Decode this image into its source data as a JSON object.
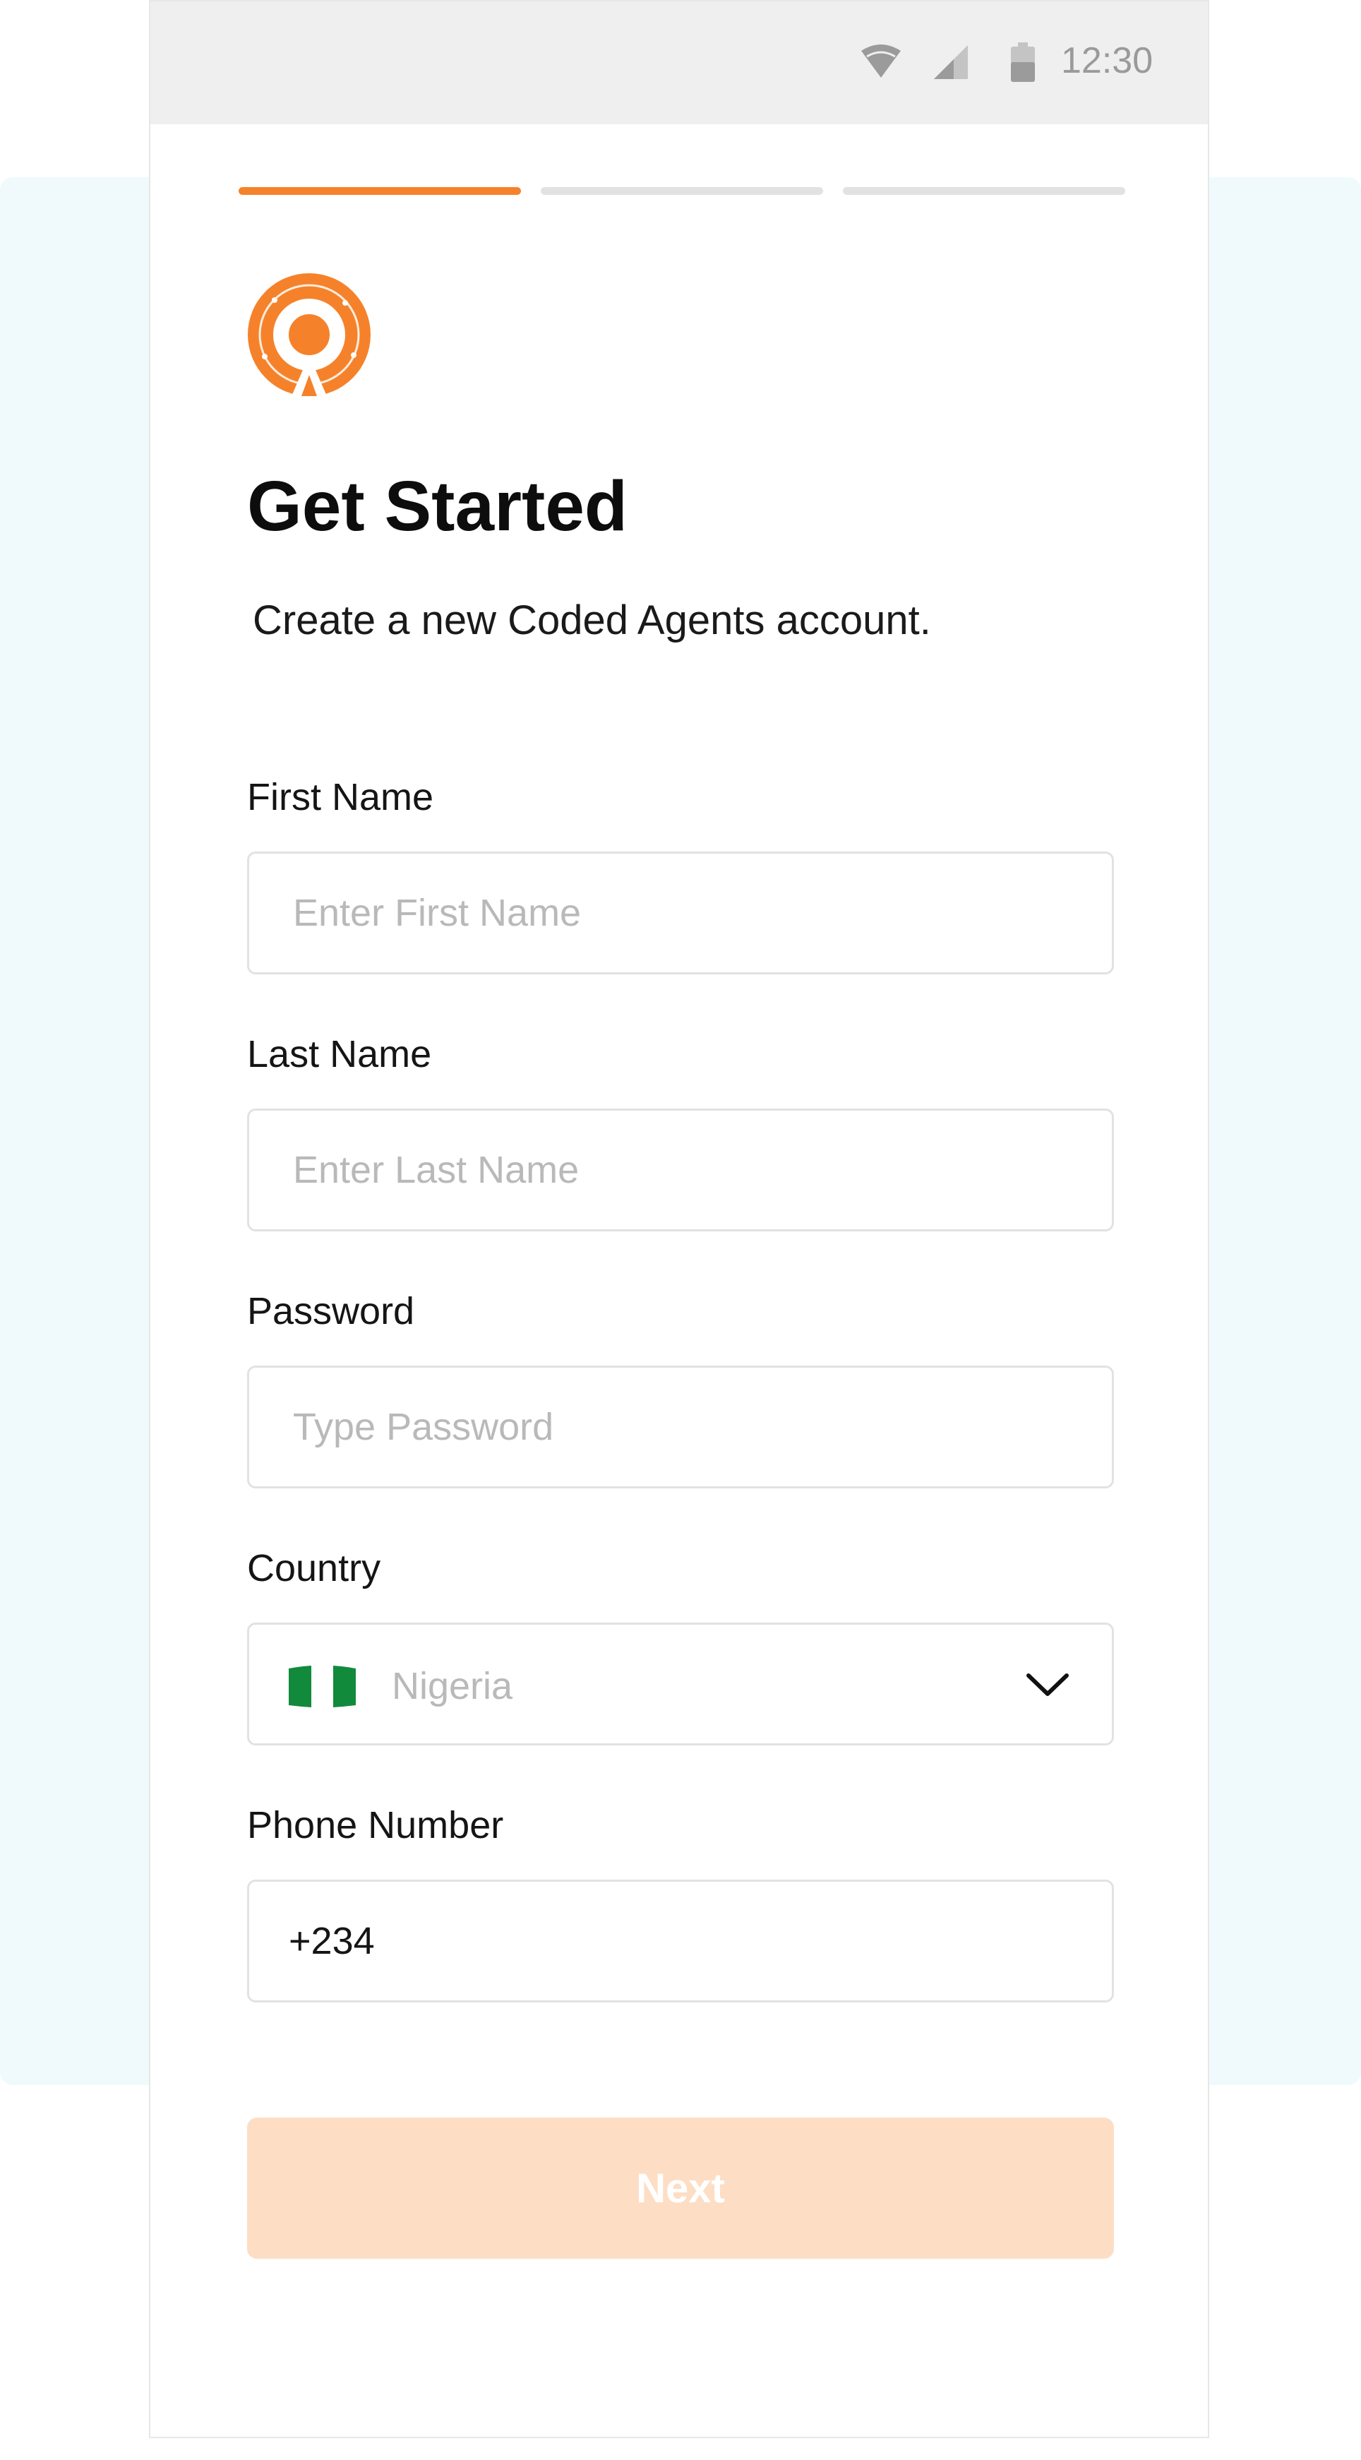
{
  "status_bar": {
    "time": "12:30",
    "icons": [
      "wifi-icon",
      "signal-icon",
      "battery-icon"
    ]
  },
  "progress": {
    "steps": 3,
    "current_step": 1
  },
  "header": {
    "logo": "coded-agents-logo",
    "title": "Get Started",
    "subtitle": "Create a new Coded Agents account."
  },
  "form": {
    "first_name": {
      "label": "First Name",
      "placeholder": "Enter First Name",
      "value": ""
    },
    "last_name": {
      "label": "Last Name",
      "placeholder": "Enter Last Name",
      "value": ""
    },
    "password": {
      "label": "Password",
      "placeholder": "Type Password",
      "value": ""
    },
    "country": {
      "label": "Country",
      "selected": "Nigeria",
      "flag": "nigeria-flag-icon"
    },
    "phone": {
      "label": "Phone Number",
      "value": "+234"
    }
  },
  "next_button": {
    "label": "Next",
    "state": "disabled"
  },
  "colors": {
    "accent": "#f5822a",
    "accent_light": "#fddec5",
    "background_panel": "#f0fafd",
    "field_border": "#e2e2e2",
    "placeholder": "#b9b9b9"
  }
}
